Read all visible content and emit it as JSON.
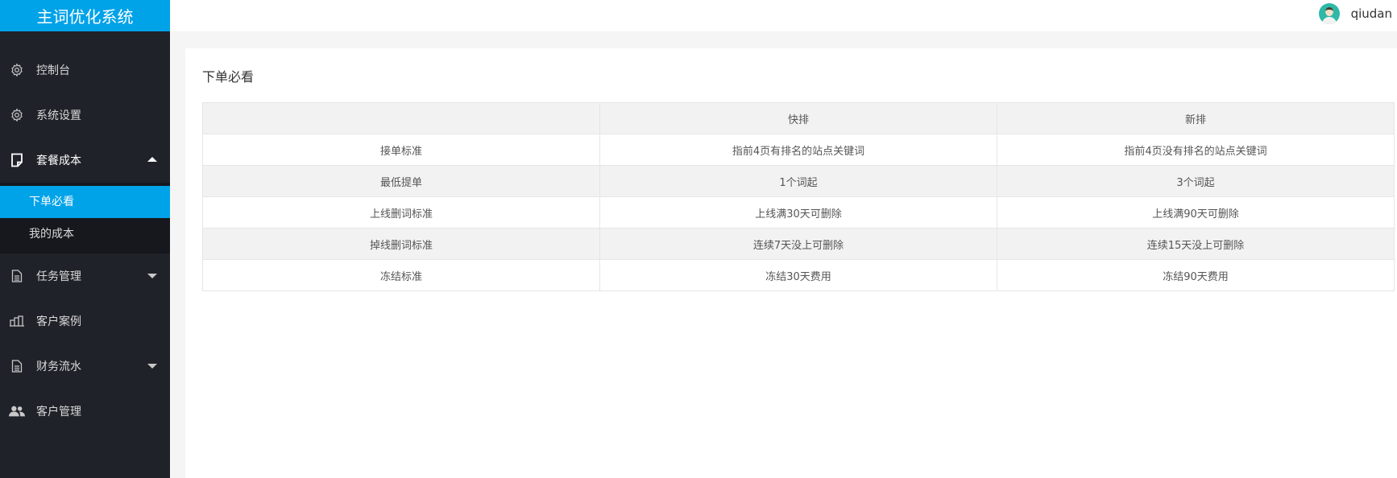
{
  "app": {
    "title": "主词优化系统"
  },
  "user": {
    "name": "qiudan"
  },
  "sidebar": {
    "items": [
      {
        "label": "控制台",
        "icon": "gear-icon"
      },
      {
        "label": "系统设置",
        "icon": "gear-icon"
      },
      {
        "label": "套餐成本",
        "icon": "document-icon",
        "expanded": true,
        "children": [
          {
            "label": "下单必看",
            "active": true
          },
          {
            "label": "我的成本"
          }
        ]
      },
      {
        "label": "任务管理",
        "icon": "file-icon"
      },
      {
        "label": "客户案例",
        "icon": "buildings-icon"
      },
      {
        "label": "财务流水",
        "icon": "file-icon"
      },
      {
        "label": "客户管理",
        "icon": "users-icon"
      }
    ]
  },
  "main": {
    "title": "下单必看",
    "table": {
      "headers": [
        "",
        "快排",
        "新排"
      ],
      "rows": [
        [
          "接单标准",
          "指前4页有排名的站点关键词",
          "指前4页没有排名的站点关键词"
        ],
        [
          "最低提单",
          "1个词起",
          "3个词起"
        ],
        [
          "上线删词标准",
          "上线满30天可删除",
          "上线满90天可删除"
        ],
        [
          "掉线删词标准",
          "连续7天没上可删除",
          "连续15天没上可删除"
        ],
        [
          "冻结标准",
          "冻结30天费用",
          "冻结90天费用"
        ]
      ]
    }
  },
  "colors": {
    "accent": "#00a2e8",
    "sidebar_bg": "#1f2229",
    "subnav_bg": "#16181d"
  }
}
